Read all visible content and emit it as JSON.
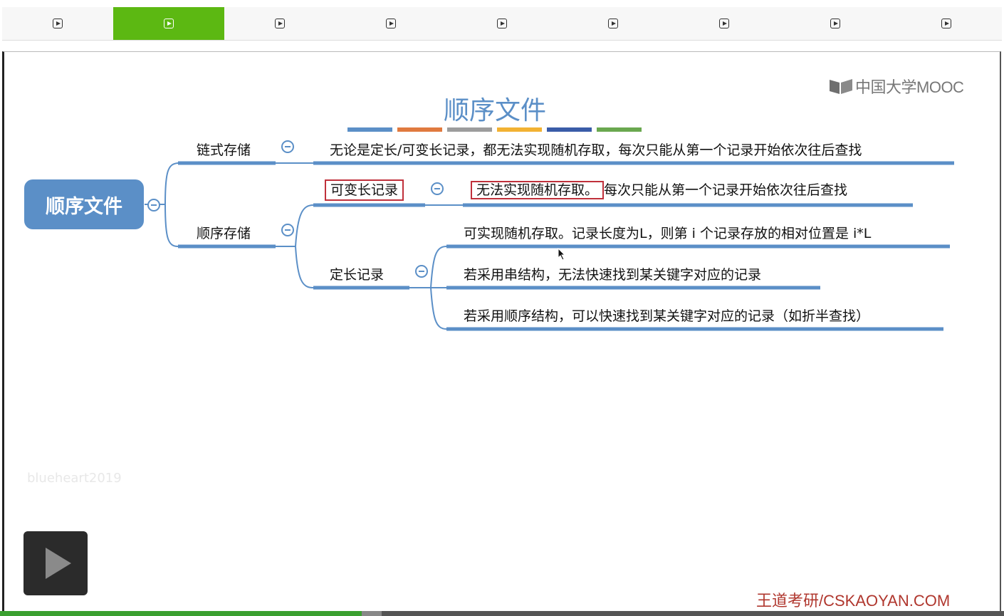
{
  "tabs": [
    {
      "icon": "play-square-icon",
      "active": false
    },
    {
      "icon": "play-square-icon",
      "active": true
    },
    {
      "icon": "play-square-icon",
      "active": false
    },
    {
      "icon": "play-square-icon",
      "active": false
    },
    {
      "icon": "play-square-icon",
      "active": false
    },
    {
      "icon": "play-square-icon",
      "active": false
    },
    {
      "icon": "play-square-icon",
      "active": false
    },
    {
      "icon": "play-square-icon",
      "active": false
    },
    {
      "icon": "play-square-icon",
      "active": false
    }
  ],
  "logo": {
    "text": "中国大学MOOC"
  },
  "slide": {
    "title": "顺序文件",
    "color_bars": [
      "#5b8fc7",
      "#e07a3f",
      "#9c9c9c",
      "#f2b233",
      "#3a5ca8",
      "#6aa84f"
    ]
  },
  "mindmap": {
    "root": "顺序文件",
    "chain_storage": {
      "label": "链式存储",
      "text": "无论是定长/可变长记录，都无法实现随机存取，每次只能从第一个记录开始依次往后查找"
    },
    "seq_storage": {
      "label": "顺序存储",
      "variable": {
        "label": "可变长记录",
        "text_boxed": "无法实现随机存取。",
        "text_rest": "每次只能从第一个记录开始依次往后查找"
      },
      "fixed": {
        "label": "定长记录",
        "items": [
          "可实现随机存取。记录长度为L，则第 i 个记录存放的相对位置是 i*L",
          "若采用串结构，无法快速找到某关键字对应的记录",
          "若采用顺序结构，可以快速找到某关键字对应的记录（如折半查找）"
        ]
      }
    }
  },
  "watermark": "blueheart2019",
  "brand": "王道考研/CSKAOYAN.COM",
  "player": {
    "progress": 0.36,
    "buffered": 0.38
  },
  "colors": {
    "accent": "#5cb812",
    "node": "#5b8fc7",
    "highlight": "#c0303b"
  }
}
